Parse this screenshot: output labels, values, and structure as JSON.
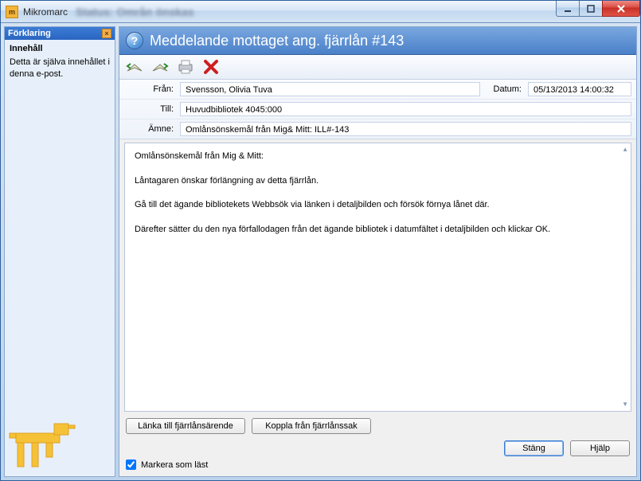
{
  "app": {
    "title": "Mikromarc",
    "background_text": "Status: Områn önskas"
  },
  "sidebar": {
    "header": "Förklaring",
    "heading": "Innehåll",
    "text": "Detta är själva innehållet i denna e-post."
  },
  "dialog": {
    "title": "Meddelande mottaget ang. fjärrlån #143"
  },
  "icons": {
    "reply": "reply-icon",
    "forward": "forward-icon",
    "print": "print-icon",
    "delete": "delete-icon"
  },
  "fields": {
    "from_label": "Från:",
    "from_value": "Svensson, Olivia Tuva",
    "date_label": "Datum:",
    "date_value": "05/13/2013 14:00:32",
    "to_label": "Till:",
    "to_value": "Huvudbibliotek 4045:000",
    "subject_label": "Ämne:",
    "subject_value": "Omlånsönskemål från Mig& Mitt: ILL#-143"
  },
  "message": {
    "p1": "Omlånsönskemål från Mig & Mitt:",
    "p2": "Låntagaren önskar förlängning av detta fjärrlån.",
    "p3": "Gå till det ägande bibliotekets Webbsök via länken i detaljbilden och försök förnya lånet där.",
    "p4": "Därefter sätter du den nya förfallodagen från det ägande bibliotek i datumfältet i detaljbilden och klickar OK."
  },
  "buttons": {
    "link": "Länka till fjärrlånsärende",
    "unlink": "Koppla från fjärrlånssak",
    "close": "Stäng",
    "help": "Hjälp"
  },
  "checkbox": {
    "mark_read": "Markera som läst",
    "checked": true
  }
}
